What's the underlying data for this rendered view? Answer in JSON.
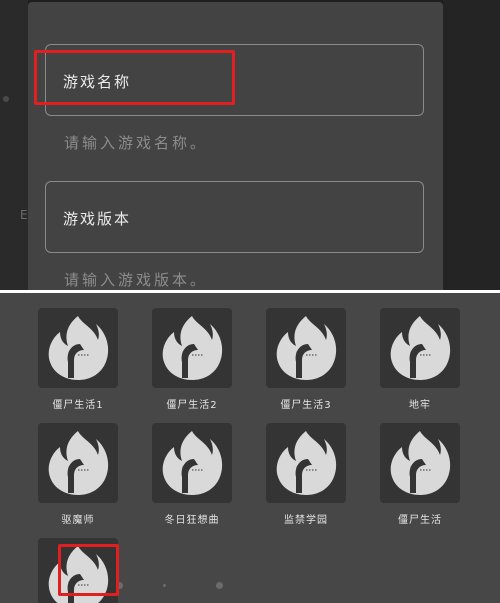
{
  "dialog": {
    "fields": [
      {
        "label": "游戏名称",
        "placeholder": "请输入游戏名称。"
      },
      {
        "label": "游戏版本",
        "placeholder": "请输入游戏版本。"
      }
    ]
  },
  "background_left_char": "E",
  "grid": {
    "apps": [
      {
        "name": "僵尸生活1",
        "icon": "flame-app-icon"
      },
      {
        "name": "僵尸生活2",
        "icon": "flame-app-icon"
      },
      {
        "name": "僵尸生活3",
        "icon": "flame-app-icon"
      },
      {
        "name": "地牢",
        "icon": "flame-app-icon"
      },
      {
        "name": "驱魔师",
        "icon": "flame-app-icon"
      },
      {
        "name": "冬日狂想曲",
        "icon": "flame-app-icon"
      },
      {
        "name": "监禁学园",
        "icon": "flame-app-icon"
      },
      {
        "name": "僵尸生活",
        "icon": "flame-app-icon"
      },
      {
        "name": "",
        "icon": "flame-app-icon"
      }
    ]
  },
  "colors": {
    "highlight": "#e02020",
    "dialog_bg": "#434343",
    "grid_bg": "#474747"
  }
}
